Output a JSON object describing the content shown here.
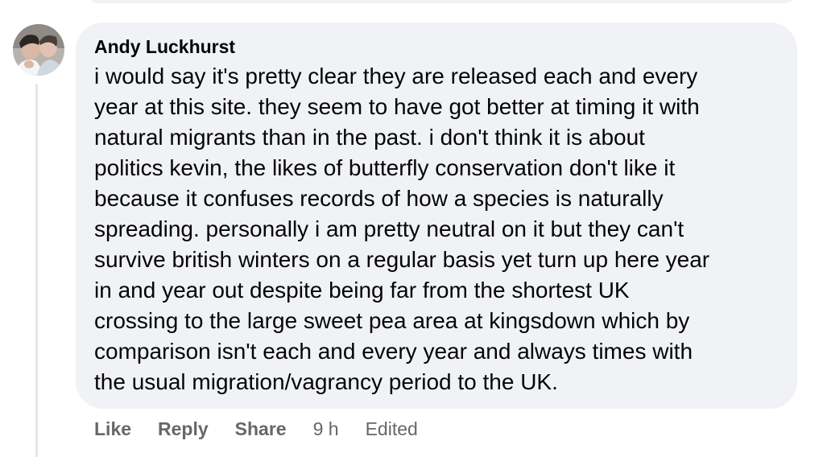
{
  "comment": {
    "author": "Andy Luckhurst",
    "avatar_icon": "profile-photo",
    "text": "i would say it's pretty clear they are released each and every\nyear at this site. they seem to have got better at timing it with\nnatural migrants than in the past. i don't think it is about\npolitics kevin, the likes of butterfly conservation don't like it\nbecause it confuses records of how a species is naturally\nspreading. personally i am pretty neutral on it but they can't\nsurvive british winters on a regular basis yet turn up here year\nin and year out despite being far from the shortest UK\ncrossing to the large sweet pea area at kingsdown which by\ncomparison isn't each and every year and always times with\nthe usual migration/vagrancy period to the UK."
  },
  "actions": {
    "like_label": "Like",
    "reply_label": "Reply",
    "share_label": "Share",
    "timestamp": "9 h",
    "edited_label": "Edited"
  },
  "colors": {
    "bubble_bg": "#f0f2f5",
    "text": "#050505",
    "secondary_text": "#65676b"
  }
}
